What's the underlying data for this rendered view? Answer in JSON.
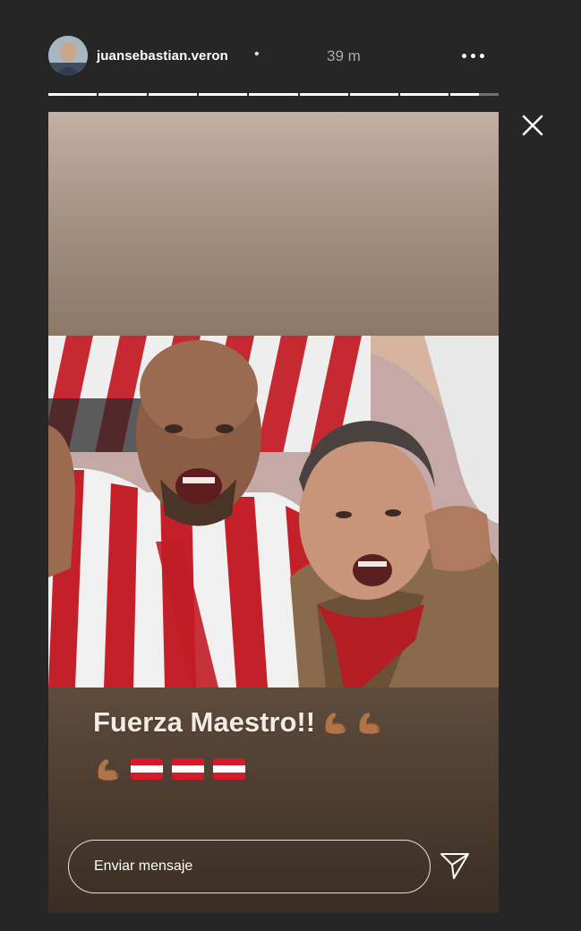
{
  "header": {
    "username": "juansebastian.veron",
    "separator": "•",
    "time": "39 m",
    "avatar_icon": "profile-avatar",
    "more_icon": "more-horizontal-icon"
  },
  "progress": {
    "total_segments": 9,
    "completed_segments": 8,
    "current_segment_fraction": 0.6
  },
  "close_icon": "close-icon",
  "story": {
    "caption_text": "Fuerza Maestro!!",
    "caption_emojis_line1": [
      "flexed-biceps-icon",
      "flexed-biceps-icon"
    ],
    "caption_emojis_line2": [
      "flexed-biceps-icon",
      "austria-flag-icon",
      "austria-flag-icon",
      "austria-flag-icon"
    ]
  },
  "footer": {
    "message_placeholder": "Enviar mensaje",
    "send_icon": "send-paper-plane-icon"
  },
  "colors": {
    "background": "#262626",
    "text": "#ffffff",
    "time_text": "#a9a9a9",
    "flag_red": "#d21a2a"
  }
}
